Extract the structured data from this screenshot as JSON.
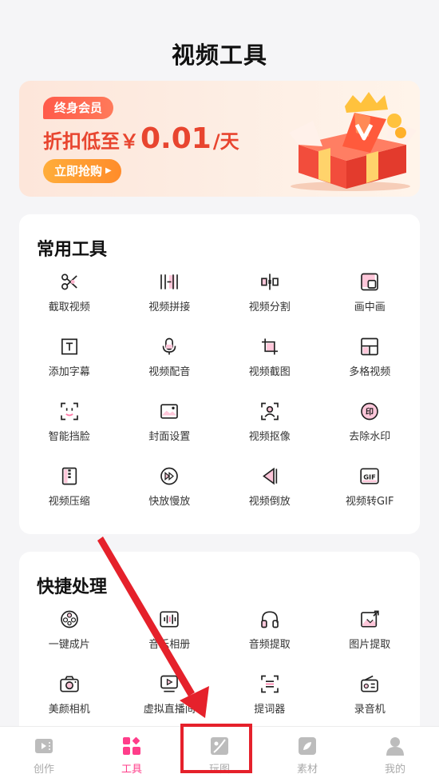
{
  "page": {
    "title": "视频工具"
  },
  "banner": {
    "badge": "终身会员",
    "discount_prefix": "折扣低至￥",
    "discount_value": "0.01",
    "discount_suffix": "/天",
    "button_label": "立即抢购"
  },
  "common_tools": {
    "title": "常用工具",
    "items": [
      {
        "label": "截取视频",
        "icon": "scissors-icon"
      },
      {
        "label": "视频拼接",
        "icon": "splice-icon"
      },
      {
        "label": "视频分割",
        "icon": "split-icon"
      },
      {
        "label": "画中画",
        "icon": "pip-icon"
      },
      {
        "label": "添加字幕",
        "icon": "text-icon"
      },
      {
        "label": "视频配音",
        "icon": "microphone-icon"
      },
      {
        "label": "视频截图",
        "icon": "crop-icon"
      },
      {
        "label": "多格视频",
        "icon": "grid-icon"
      },
      {
        "label": "智能挡脸",
        "icon": "face-icon"
      },
      {
        "label": "封面设置",
        "icon": "image-icon"
      },
      {
        "label": "视频抠像",
        "icon": "portrait-icon"
      },
      {
        "label": "去除水印",
        "icon": "stamp-icon"
      },
      {
        "label": "视频压缩",
        "icon": "compress-icon"
      },
      {
        "label": "快放慢放",
        "icon": "fast-forward-icon"
      },
      {
        "label": "视频倒放",
        "icon": "rewind-icon"
      },
      {
        "label": "视频转GIF",
        "icon": "gif-icon"
      }
    ]
  },
  "quick_tools": {
    "title": "快捷处理",
    "items": [
      {
        "label": "一键成片",
        "icon": "film-reel-icon"
      },
      {
        "label": "音乐相册",
        "icon": "audio-wave-icon"
      },
      {
        "label": "音频提取",
        "icon": "headphones-icon"
      },
      {
        "label": "图片提取",
        "icon": "picture-extract-icon"
      },
      {
        "label": "美颜相机",
        "icon": "camera-icon"
      },
      {
        "label": "虚拟直播间",
        "icon": "live-tv-icon"
      },
      {
        "label": "提词器",
        "icon": "teleprompter-icon"
      },
      {
        "label": "录音机",
        "icon": "radio-icon"
      }
    ]
  },
  "tabbar": {
    "active": "工具",
    "items": [
      {
        "label": "创作",
        "icon": "create-icon"
      },
      {
        "label": "工具",
        "icon": "tools-icon"
      },
      {
        "label": "玩图",
        "icon": "play-image-icon"
      },
      {
        "label": "素材",
        "icon": "material-icon"
      },
      {
        "label": "我的",
        "icon": "profile-icon"
      }
    ]
  },
  "colors": {
    "accent": "#ff3d8a",
    "discount": "#e8452f",
    "annotation": "#e5212b"
  }
}
